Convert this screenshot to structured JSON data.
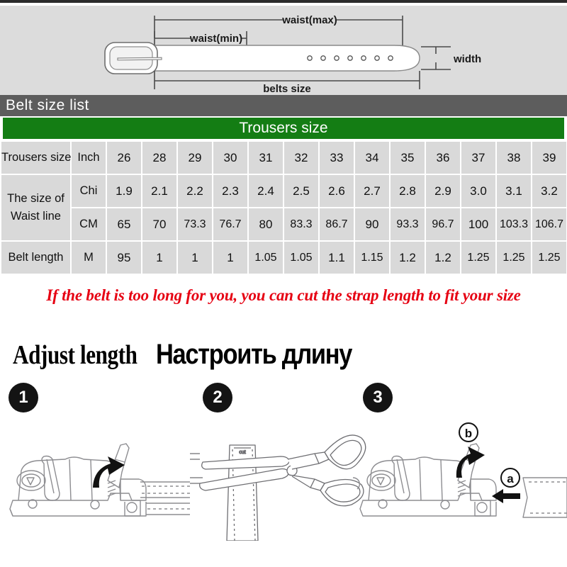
{
  "diagram": {
    "labels": {
      "waist_max": "waist(max)",
      "waist_min": "waist(min)",
      "belts_size": "belts size",
      "width": "width"
    },
    "hole_count": 7,
    "background_color": "#dcdcdc"
  },
  "belt_size_bar": {
    "title": "Belt size  list",
    "background_color": "#5d5d5d",
    "text_color": "#ffffff"
  },
  "trousers_bar": {
    "title": "Trousers size",
    "background_color": "#147d14",
    "text_color": "#ffffff"
  },
  "table": {
    "row_labels": {
      "trousers_size": "Trousers size",
      "waist_line_line1": "The size of",
      "waist_line_line2": "Waist line",
      "belt_length": "Belt length"
    },
    "units": {
      "inch": "Inch",
      "chi": "Chi",
      "cm": "CM",
      "m": "M"
    },
    "rows": [
      {
        "label": "Trousers size",
        "unit": "Inch",
        "values": [
          "26",
          "28",
          "29",
          "30",
          "31",
          "32",
          "33",
          "34",
          "35",
          "36",
          "37",
          "38",
          "39"
        ]
      },
      {
        "label": "The size of Waist line",
        "unit": "Chi",
        "values": [
          "1.9",
          "2.1",
          "2.2",
          "2.3",
          "2.4",
          "2.5",
          "2.6",
          "2.7",
          "2.8",
          "2.9",
          "3.0",
          "3.1",
          "3.2"
        ]
      },
      {
        "label": "",
        "unit": "CM",
        "values": [
          "65",
          "70",
          "73.3",
          "76.7",
          "80",
          "83.3",
          "86.7",
          "90",
          "93.3",
          "96.7",
          "100",
          "103.3",
          "106.7"
        ]
      },
      {
        "label": "Belt length",
        "unit": "M",
        "values": [
          "95",
          "1",
          "1",
          "1",
          "1.05",
          "1.05",
          "1.1",
          "1.15",
          "1.2",
          "1.2",
          "1.25",
          "1.25",
          "1.25"
        ]
      }
    ],
    "cell_background": "#d9d9d9"
  },
  "note": {
    "text": "If the belt is too long for you, you can cut the strap length to fit your size",
    "color": "#e60012"
  },
  "headings": {
    "english": "Adjust length",
    "russian": "Настроить длину"
  },
  "steps": [
    {
      "number": "1",
      "name": "lift-lever"
    },
    {
      "number": "2",
      "name": "cut-strap"
    },
    {
      "number": "3",
      "name": "reinsert-strap"
    }
  ],
  "step3_callouts": {
    "a": "a",
    "b": "b"
  }
}
